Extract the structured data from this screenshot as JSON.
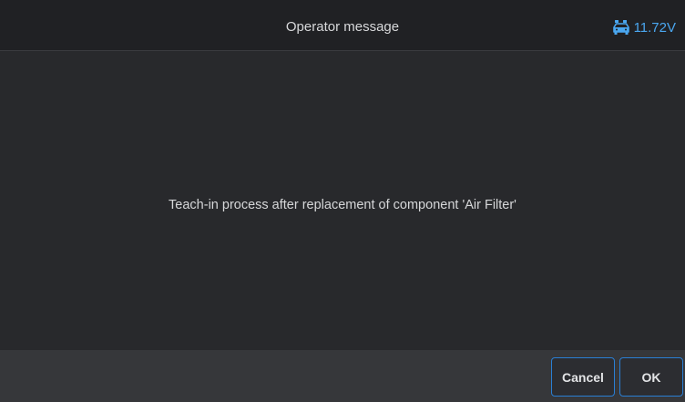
{
  "header": {
    "title": "Operator message",
    "voltage": "11.72V",
    "battery_icon": "car-battery-icon",
    "accent_color": "#4aa7f0"
  },
  "main": {
    "message": "Teach-in process after replacement of component 'Air Filter'"
  },
  "footer": {
    "cancel_label": "Cancel",
    "ok_label": "OK"
  }
}
